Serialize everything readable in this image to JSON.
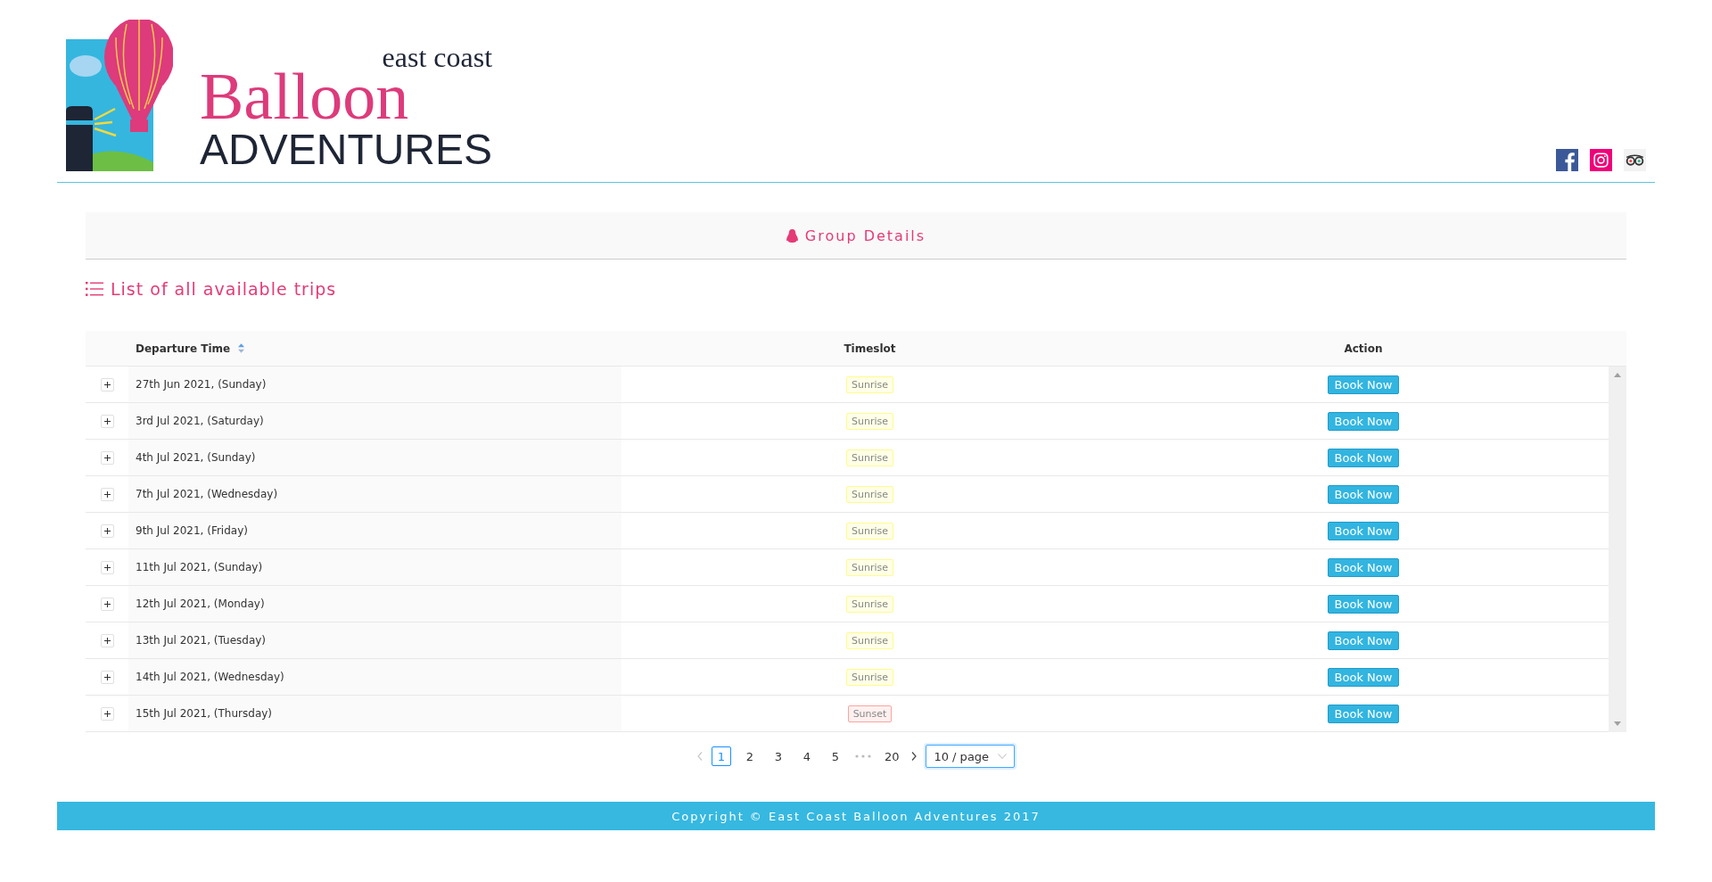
{
  "logo": {
    "small": "east coast",
    "big": "Balloon",
    "bottom": "ADVENTURES"
  },
  "group_details": {
    "label": "Group Details"
  },
  "list_title": "List of all available trips",
  "table": {
    "columns": [
      "Departure Time",
      "Timeslot",
      "Action"
    ],
    "rows": [
      {
        "departure": "27th Jun 2021, (Sunday)",
        "timeslot": "Sunrise",
        "kind": "sunrise",
        "action": "Book Now"
      },
      {
        "departure": "3rd Jul 2021, (Saturday)",
        "timeslot": "Sunrise",
        "kind": "sunrise",
        "action": "Book Now"
      },
      {
        "departure": "4th Jul 2021, (Sunday)",
        "timeslot": "Sunrise",
        "kind": "sunrise",
        "action": "Book Now"
      },
      {
        "departure": "7th Jul 2021, (Wednesday)",
        "timeslot": "Sunrise",
        "kind": "sunrise",
        "action": "Book Now"
      },
      {
        "departure": "9th Jul 2021, (Friday)",
        "timeslot": "Sunrise",
        "kind": "sunrise",
        "action": "Book Now"
      },
      {
        "departure": "11th Jul 2021, (Sunday)",
        "timeslot": "Sunrise",
        "kind": "sunrise",
        "action": "Book Now"
      },
      {
        "departure": "12th Jul 2021, (Monday)",
        "timeslot": "Sunrise",
        "kind": "sunrise",
        "action": "Book Now"
      },
      {
        "departure": "13th Jul 2021, (Tuesday)",
        "timeslot": "Sunrise",
        "kind": "sunrise",
        "action": "Book Now"
      },
      {
        "departure": "14th Jul 2021, (Wednesday)",
        "timeslot": "Sunrise",
        "kind": "sunrise",
        "action": "Book Now"
      },
      {
        "departure": "15th Jul 2021, (Thursday)",
        "timeslot": "Sunset",
        "kind": "sunset",
        "action": "Book Now"
      }
    ]
  },
  "pagination": {
    "pages": [
      {
        "label": "1",
        "selected": true
      },
      {
        "label": "2",
        "selected": false
      },
      {
        "label": "3",
        "selected": false
      },
      {
        "label": "4",
        "selected": false
      },
      {
        "label": "5",
        "selected": false
      },
      {
        "label": "20",
        "selected": false
      }
    ],
    "page_size": "10 / page"
  },
  "footer": "Copyright © East Coast Balloon Adventures 2017"
}
